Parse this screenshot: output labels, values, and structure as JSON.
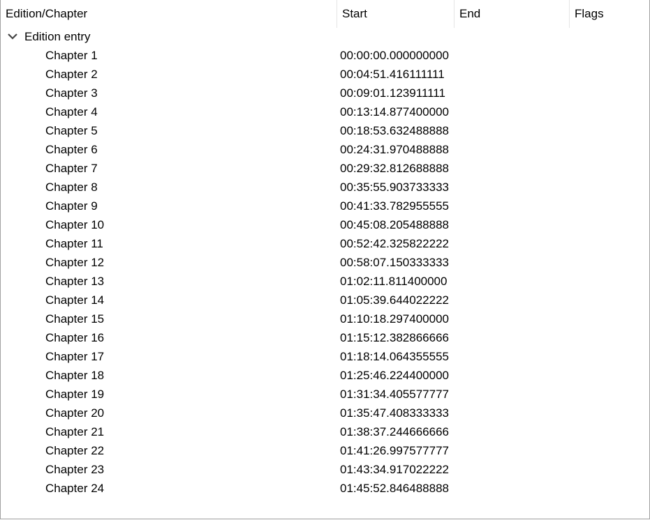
{
  "columns": [
    "Edition/Chapter",
    "Start",
    "End",
    "Flags"
  ],
  "edition": {
    "label": "Edition entry",
    "expanded": true
  },
  "chapters": [
    {
      "name": "Chapter 1",
      "start": "00:00:00.000000000"
    },
    {
      "name": "Chapter 2",
      "start": "00:04:51.416111111"
    },
    {
      "name": "Chapter 3",
      "start": "00:09:01.123911111"
    },
    {
      "name": "Chapter 4",
      "start": "00:13:14.877400000"
    },
    {
      "name": "Chapter 5",
      "start": "00:18:53.632488888"
    },
    {
      "name": "Chapter 6",
      "start": "00:24:31.970488888"
    },
    {
      "name": "Chapter 7",
      "start": "00:29:32.812688888"
    },
    {
      "name": "Chapter 8",
      "start": "00:35:55.903733333"
    },
    {
      "name": "Chapter 9",
      "start": "00:41:33.782955555"
    },
    {
      "name": "Chapter 10",
      "start": "00:45:08.205488888"
    },
    {
      "name": "Chapter 11",
      "start": "00:52:42.325822222"
    },
    {
      "name": "Chapter 12",
      "start": "00:58:07.150333333"
    },
    {
      "name": "Chapter 13",
      "start": "01:02:11.811400000"
    },
    {
      "name": "Chapter 14",
      "start": "01:05:39.644022222"
    },
    {
      "name": "Chapter 15",
      "start": "01:10:18.297400000"
    },
    {
      "name": "Chapter 16",
      "start": "01:15:12.382866666"
    },
    {
      "name": "Chapter 17",
      "start": "01:18:14.064355555"
    },
    {
      "name": "Chapter 18",
      "start": "01:25:46.224400000"
    },
    {
      "name": "Chapter 19",
      "start": "01:31:34.405577777"
    },
    {
      "name": "Chapter 20",
      "start": "01:35:47.408333333"
    },
    {
      "name": "Chapter 21",
      "start": "01:38:37.244666666"
    },
    {
      "name": "Chapter 22",
      "start": "01:41:26.997577777"
    },
    {
      "name": "Chapter 23",
      "start": "01:43:34.917022222"
    },
    {
      "name": "Chapter 24",
      "start": "01:45:52.846488888"
    }
  ]
}
